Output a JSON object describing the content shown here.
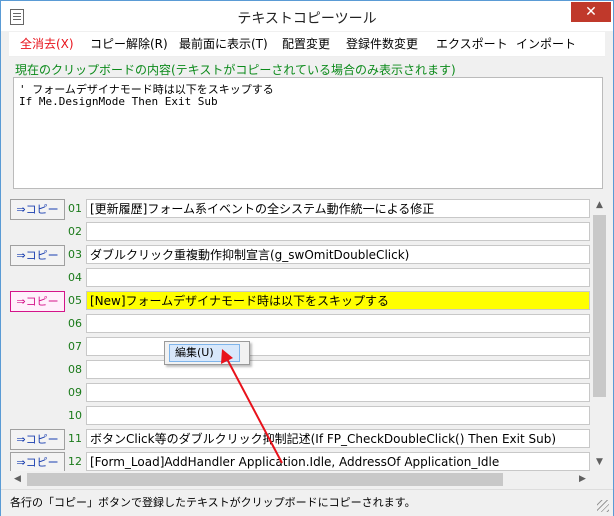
{
  "window": {
    "title": "テキストコピーツール",
    "close_glyph": "✕"
  },
  "menu": [
    {
      "label": "全消去(X)",
      "color": "#e8121b"
    },
    {
      "label": "コピー解除(R)",
      "color": "#000000"
    },
    {
      "label": "最前面に表示(T)",
      "color": "#000000"
    },
    {
      "label": "配置変更",
      "color": "#000000"
    },
    {
      "label": "登録件数変更",
      "color": "#000000"
    },
    {
      "label": "エクスポート",
      "color": "#000000"
    },
    {
      "label": "インポート",
      "color": "#000000"
    }
  ],
  "clipboard": {
    "label": "現在のクリップボードの内容(テキストがコピーされている場合のみ表示されます)",
    "lines": [
      "' フォームデザイナモード時は以下をスキップする",
      "If Me.DesignMode Then Exit Sub"
    ]
  },
  "copy_label": "⇒コピー",
  "rows": [
    {
      "num": "01",
      "text": "[更新履歴]フォーム系イベントの全システム動作統一による修正"
    },
    {
      "num": "02",
      "text": ""
    },
    {
      "num": "03",
      "text": "ダブルクリック重複動作抑制宣言(g_swOmitDoubleClick)"
    },
    {
      "num": "04",
      "text": ""
    },
    {
      "num": "05",
      "text": "[New]フォームデザイナモード時は以下をスキップする"
    },
    {
      "num": "06",
      "text": ""
    },
    {
      "num": "07",
      "text": ""
    },
    {
      "num": "08",
      "text": ""
    },
    {
      "num": "09",
      "text": ""
    },
    {
      "num": "10",
      "text": ""
    },
    {
      "num": "11",
      "text": "ボタンClick等のダブルクリック抑制記述(If FP_CheckDoubleClick() Then Exit Sub)"
    },
    {
      "num": "12",
      "text": "[Form_Load]AddHandler Application.Idle, AddressOf Application_Idle"
    }
  ],
  "context_menu": {
    "item": "編集(U)"
  },
  "status": {
    "text": "各行の「コピー」ボタンで登録したテキストがクリップボードにコピーされます。"
  },
  "colors": {
    "highlight": "#ffff00",
    "arrow": "#e8121b",
    "row_number": "#1a7a1a",
    "copy_button": "#1a3fb0",
    "active_copy_button": "#d4148a"
  }
}
